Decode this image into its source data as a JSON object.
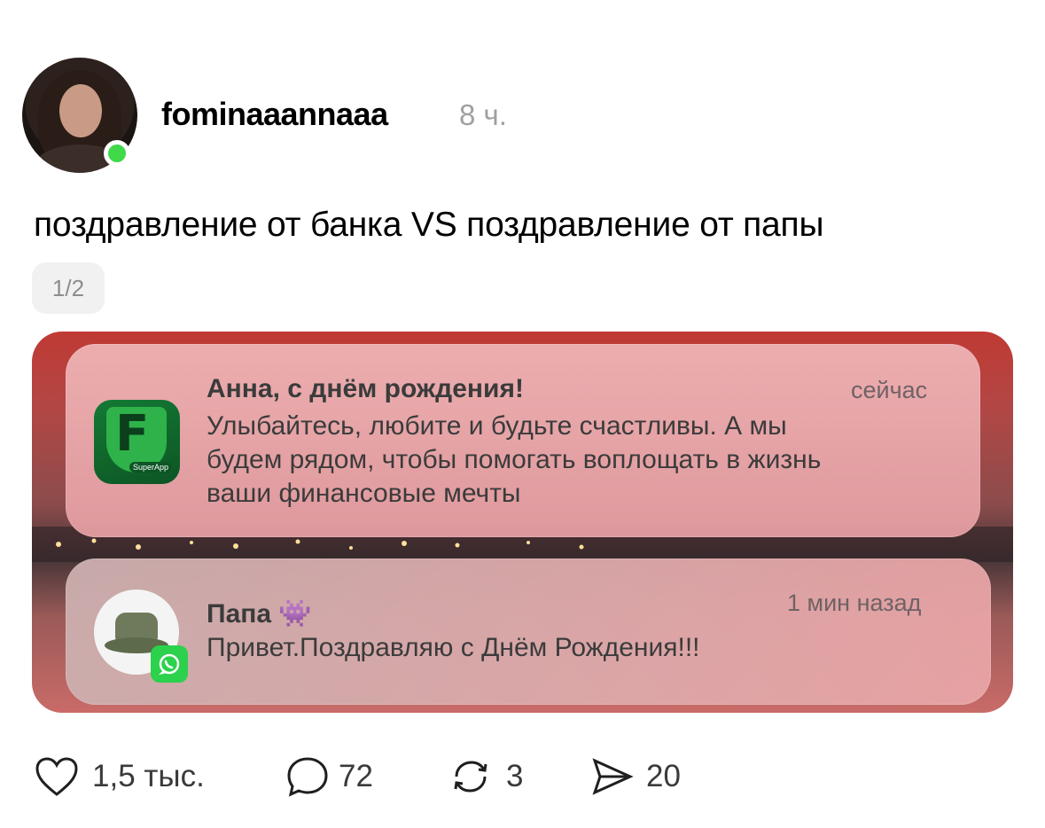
{
  "post": {
    "username": "fominaaannaaa",
    "time": "8 ч.",
    "text": "поздравление от банка VS поздравление от папы",
    "page_indicator": "1/2"
  },
  "notifications": [
    {
      "title": "Анна, с днём рождения!",
      "time": "сейчас",
      "body_lines": [
        "Улыбайтесь, любите и будьте счастливы. А мы",
        "будем рядом, чтобы помогать воплощать в жизнь",
        "ваши финансовые мечты"
      ],
      "icon_label": "SuperApp"
    },
    {
      "title": "Папа 👾",
      "time": "1 мин назад",
      "body": "Привет.Поздравляю с Днём Рождения!!!"
    }
  ],
  "actions": {
    "likes": "1,5 тыс.",
    "comments": "72",
    "reposts": "3",
    "shares": "20"
  }
}
